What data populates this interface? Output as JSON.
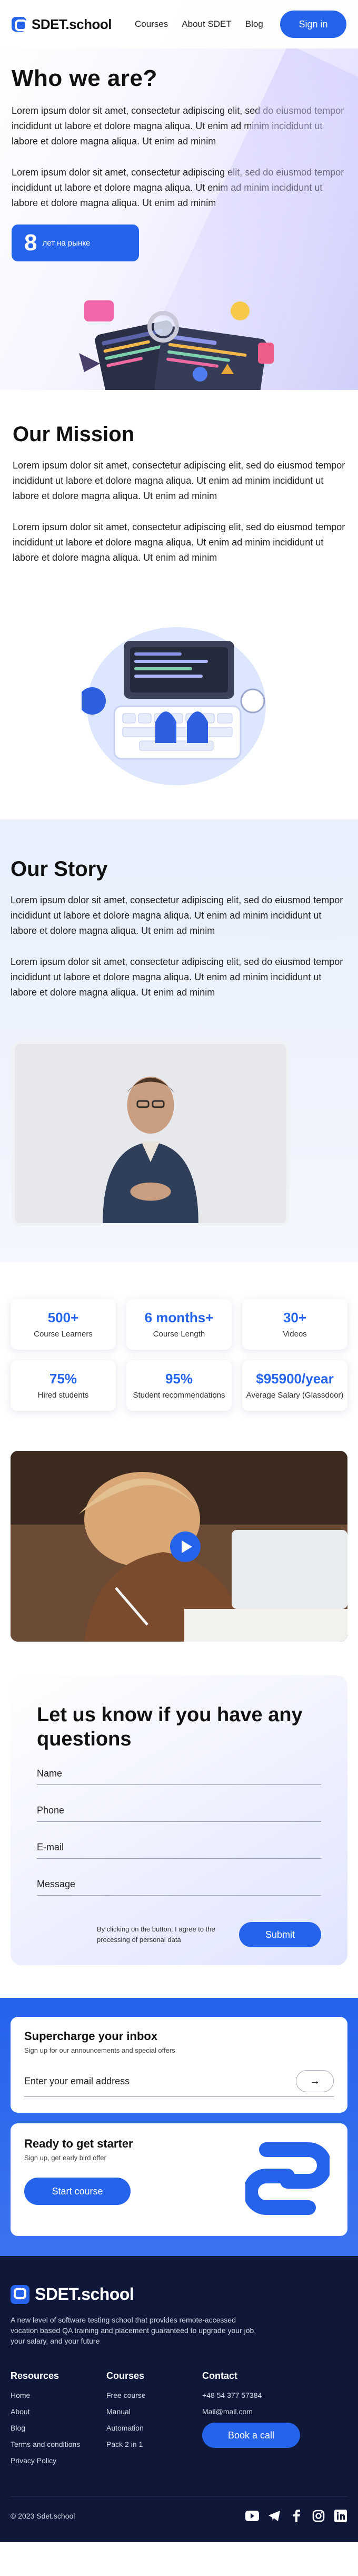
{
  "header": {
    "brand": "SDET.school",
    "nav": [
      "Courses",
      "About SDET",
      "Blog"
    ],
    "signin_label": "Sign in"
  },
  "about": {
    "title": "Who we are?",
    "paragraphs": [
      "Lorem ipsum dolor sit amet, consectetur adipiscing elit, sed do eiusmod tempor incididunt ut labore et dolore magna aliqua. Ut enim ad minim incididunt ut labore et dolore magna aliqua. Ut enim ad minim",
      "Lorem ipsum dolor sit amet, consectetur adipiscing elit, sed do eiusmod tempor incididunt ut labore et dolore magna aliqua. Ut enim ad minim incididunt ut labore et dolore magna aliqua. Ut enim ad minim"
    ],
    "years_number": "8",
    "years_label": "лет на рынке"
  },
  "mission": {
    "title": "Our Mission",
    "paragraphs": [
      "Lorem ipsum dolor sit amet, consectetur adipiscing elit, sed do eiusmod tempor incididunt ut labore et dolore magna aliqua. Ut enim ad minim incididunt ut labore et dolore magna aliqua. Ut enim ad minim",
      "Lorem ipsum dolor sit amet, consectetur adipiscing elit, sed do eiusmod tempor incididunt ut labore et dolore magna aliqua. Ut enim ad minim incididunt ut labore et dolore magna aliqua. Ut enim ad minim"
    ]
  },
  "story": {
    "title": "Our Story",
    "paragraphs": [
      "Lorem ipsum dolor sit amet, consectetur adipiscing elit, sed do eiusmod tempor incididunt ut labore et dolore magna aliqua. Ut enim ad minim incididunt ut labore et dolore magna aliqua. Ut enim ad minim",
      "Lorem ipsum dolor sit amet, consectetur adipiscing elit, sed do eiusmod tempor incididunt ut labore et dolore magna aliqua. Ut enim ad minim incididunt ut labore et dolore magna aliqua. Ut enim ad minim"
    ]
  },
  "stats": [
    {
      "value": "500+",
      "label": "Course Learners"
    },
    {
      "value": "6 months+",
      "label": "Course Length"
    },
    {
      "value": "30+",
      "label": "Videos"
    },
    {
      "value": "75%",
      "label": "Hired students"
    },
    {
      "value": "95%",
      "label": "Student recommendations"
    },
    {
      "value": "$95900/year",
      "label": "Average Salary (Glassdoor)"
    }
  ],
  "contact_form": {
    "title": "Let us know if you have any questions",
    "name_placeholder": "Name",
    "phone_placeholder": "Phone",
    "email_placeholder": "E-mail",
    "message_placeholder": "Message",
    "consent": "By clicking on the button, I agree to the processing of personal data",
    "submit_label": "Submit"
  },
  "newsletter": {
    "title": "Supercharge your inbox",
    "subtitle": "Sign up for our announcements and special offers",
    "email_placeholder": "Enter your email address"
  },
  "starter": {
    "title": "Ready to get starter",
    "subtitle": "Sign up, get early bird offer",
    "button_label": "Start course"
  },
  "footer": {
    "brand": "SDET.school",
    "description": "A new level of software testing school that provides remote-accessed vocation based QA training and placement guaranteed to upgrade your job, your salary, and your future",
    "resources_title": "Resources",
    "resources": [
      "Home",
      "About",
      "Blog",
      "Terms and conditions",
      "Privacy Policy"
    ],
    "courses_title": "Courses",
    "courses": [
      "Free course",
      "Manual",
      "Automation",
      "Pack 2 in 1"
    ],
    "contact_title": "Contact",
    "phone": "+48 54 377 57384",
    "email": "Mail@mail.com",
    "call_label": "Book a call",
    "copyright": "© 2023 Sdet.school"
  },
  "colors": {
    "accent": "#2563eb",
    "footer_bg": "#0f1838"
  }
}
